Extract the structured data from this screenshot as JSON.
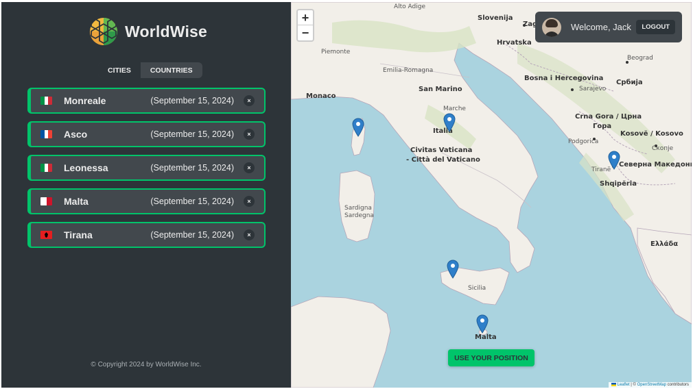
{
  "app": {
    "name": "WorldWise",
    "footer": "© Copyright 2024 by WorldWise Inc."
  },
  "tabs": [
    {
      "label": "Cities",
      "active": true
    },
    {
      "label": "Countries",
      "active": false
    }
  ],
  "cities": [
    {
      "name": "Monreale",
      "date": "(September 15, 2024)",
      "flag": [
        "#009246",
        "#ffffff",
        "#ce2b37"
      ]
    },
    {
      "name": "Asco",
      "date": "(September 15, 2024)",
      "flag": [
        "#0055a4",
        "#ffffff",
        "#ef4135"
      ]
    },
    {
      "name": "Leonessa",
      "date": "(September 15, 2024)",
      "flag": [
        "#009246",
        "#ffffff",
        "#ce2b37"
      ]
    },
    {
      "name": "Malta",
      "date": "(September 15, 2024)",
      "flag": [
        "#ffffff",
        "#ffffff",
        "#cf142b"
      ]
    },
    {
      "name": "Tirana",
      "date": "(September 15, 2024)",
      "flag": [
        "#e41e20",
        "#e41e20",
        "#e41e20"
      ]
    }
  ],
  "delete_label": "×",
  "user": {
    "welcome": "Welcome, Jack",
    "logout": "LOGOUT"
  },
  "map": {
    "zoom_in": "+",
    "zoom_out": "−",
    "use_position": "USE YOUR POSITION",
    "attribution_leaflet": "Leaflet",
    "attribution_sep": " | © ",
    "attribution_osm": "OpenStreetMap",
    "attribution_tail": " contributors",
    "labels": [
      "Slovenija",
      "Zagreb",
      "Hrvatska",
      "Beograd",
      "Bosna i Hercegovina",
      "Sarajevo",
      "Србија",
      "Monaco",
      "San Marino",
      "Marche",
      "Italia",
      "Civitas Vaticana",
      "- Città del Vaticano",
      "Crna Gora / Црна",
      "Гора",
      "Podgorica",
      "Kosovë / Kosovo",
      "Скопје",
      "Tiranë",
      "Северна Македонија",
      "Shqipëria",
      "Ελλάδα",
      "Sardigna",
      "Sardegna",
      "Sicilia",
      "Malta",
      "Emilia-Romagna",
      "Piemonte",
      "Alto Adige"
    ]
  },
  "colors": {
    "sidebar_bg": "#2d3439",
    "item_bg": "#42484d",
    "accent": "#00c46a",
    "sea": "#aad3df",
    "land": "#f2efe9"
  },
  "icons": {
    "logo": "globe-hex-logo-icon",
    "delete": "close-icon",
    "marker": "map-pin-icon"
  }
}
